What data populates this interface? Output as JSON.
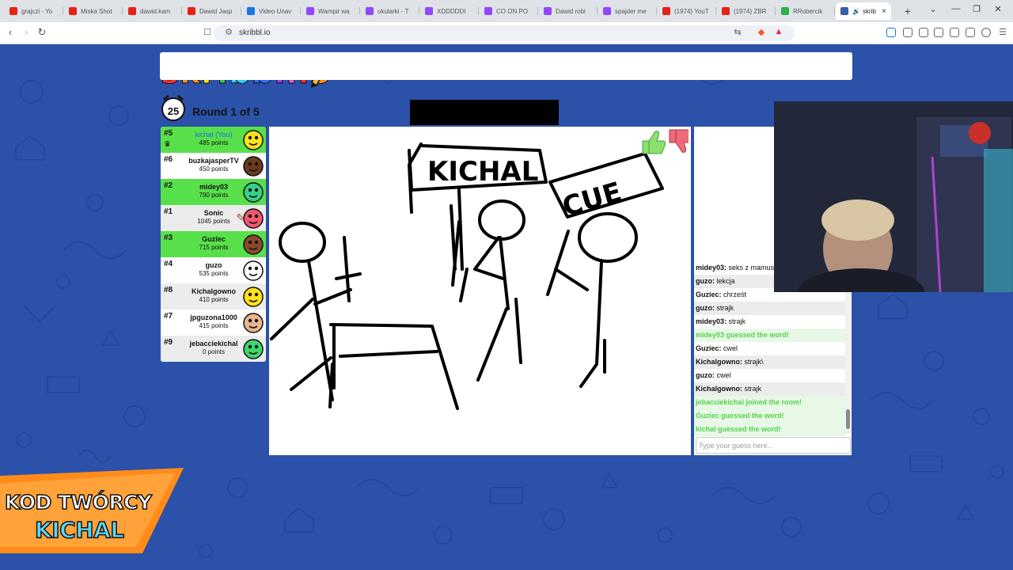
{
  "browser": {
    "tabs": [
      {
        "title": "grajczi - Yo",
        "icon": "youtube-icon",
        "color": "#e62117"
      },
      {
        "title": "Miska Shot",
        "icon": "youtube-icon",
        "color": "#e62117"
      },
      {
        "title": "dawid.kam",
        "icon": "youtube-icon",
        "color": "#e62117"
      },
      {
        "title": "Dawid Jasp",
        "icon": "youtube-icon",
        "color": "#e62117"
      },
      {
        "title": "Video Unav",
        "icon": "globe-icon",
        "color": "#1a73e8"
      },
      {
        "title": "Wampir wa",
        "icon": "twitch-icon",
        "color": "#9146ff"
      },
      {
        "title": "okularki - T",
        "icon": "twitch-icon",
        "color": "#9146ff"
      },
      {
        "title": "XDDDDDI",
        "icon": "twitch-icon",
        "color": "#9146ff"
      },
      {
        "title": "CO ON PO",
        "icon": "twitch-icon",
        "color": "#9146ff"
      },
      {
        "title": "Dawid robi",
        "icon": "twitch-icon",
        "color": "#9146ff"
      },
      {
        "title": "spajder me",
        "icon": "twitch-icon",
        "color": "#9146ff"
      },
      {
        "title": "(1974) YouT",
        "icon": "youtube-icon",
        "color": "#e62117"
      },
      {
        "title": "(1974) ZBR",
        "icon": "youtube-icon",
        "color": "#e62117"
      },
      {
        "title": "RRobercik",
        "icon": "bookmark-icon",
        "color": "#2bb24c"
      }
    ],
    "active_tab": {
      "title": "skrib",
      "close": "×"
    },
    "new_tab": "+",
    "url": "skribbl.io"
  },
  "game": {
    "logo": [
      "s",
      "k",
      "r",
      "i",
      "b",
      "b",
      "l",
      ".",
      "i",
      "o"
    ],
    "logo_colors": [
      "#ff2e2e",
      "#ff8a1c",
      "#ffe300",
      "#39d13d",
      "#2bd1ff",
      "#2a6bff",
      "#a73bff",
      "#ff4fd0",
      "#ff2e2e",
      "#ff8a1c"
    ],
    "timer": "25",
    "round_text": "Round 1 of 5",
    "players": [
      {
        "rank": "#5",
        "name": "kichal (You)",
        "points": "485 points",
        "bg": "#58e04a",
        "avatar": "#ffe11c",
        "self": true
      },
      {
        "rank": "#6",
        "name": "buzkajasperTV",
        "points": "450 points",
        "bg": "#ffffff",
        "avatar": "#6a3a1b",
        "self": false
      },
      {
        "rank": "#2",
        "name": "midey03",
        "points": "790 points",
        "bg": "#58e04a",
        "avatar": "#36d089",
        "self": false
      },
      {
        "rank": "#1",
        "name": "Sonic",
        "points": "1045 points",
        "bg": "#ececec",
        "avatar": "#f2566f",
        "self": false
      },
      {
        "rank": "#3",
        "name": "Guziec",
        "points": "715 points",
        "bg": "#58e04a",
        "avatar": "#8a4a2b",
        "self": false
      },
      {
        "rank": "#4",
        "name": "guzo",
        "points": "535 points",
        "bg": "#ffffff",
        "avatar": "#ffffff",
        "self": false
      },
      {
        "rank": "#8",
        "name": "Kichalgowno",
        "points": "410 points",
        "bg": "#ececec",
        "avatar": "#ffe11c",
        "self": false
      },
      {
        "rank": "#7",
        "name": "jpguzona1000",
        "points": "415 points",
        "bg": "#ffffff",
        "avatar": "#e8b58c",
        "self": false
      },
      {
        "rank": "#9",
        "name": "jebacciekichal",
        "points": "0 points",
        "bg": "#ececec",
        "avatar": "#3fd66b",
        "self": false
      }
    ],
    "chat": [
      {
        "user": "midey03:",
        "text": "seks z mamus",
        "kind": "normal"
      },
      {
        "user": "guzo:",
        "text": "lekcja",
        "kind": "alt"
      },
      {
        "user": "Guziec:",
        "text": "chrześt",
        "kind": "normal"
      },
      {
        "user": "guzo:",
        "text": "strajk",
        "kind": "alt"
      },
      {
        "user": "midey03:",
        "text": "strajk",
        "kind": "normal"
      },
      {
        "user": "",
        "text": "midey03 guessed the word!",
        "kind": "green"
      },
      {
        "user": "Guziec:",
        "text": "cwel",
        "kind": "normal"
      },
      {
        "user": "Kichalgowno:",
        "text": "strajk\\",
        "kind": "alt"
      },
      {
        "user": "guzo:",
        "text": "cwel",
        "kind": "normal"
      },
      {
        "user": "Kichalgowno:",
        "text": "strajk",
        "kind": "alt"
      },
      {
        "user": "",
        "text": "jebacciekichal joined the room!",
        "kind": "green"
      },
      {
        "user": "",
        "text": "Guziec guessed the word!",
        "kind": "green"
      },
      {
        "user": "",
        "text": "kichal guessed the word!",
        "kind": "green"
      }
    ],
    "guess_placeholder": "Type your guess here...",
    "drawing_texts": [
      "KICHAL",
      "CUE"
    ]
  },
  "overlay": {
    "banner_line1": "KOD TWÓRCY",
    "banner_line2": "KICHAL",
    "banner_color": "#ff8c1a"
  }
}
